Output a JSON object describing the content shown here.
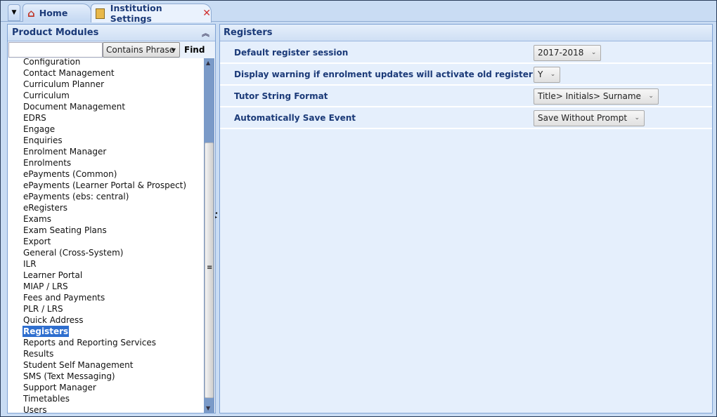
{
  "tabs": [
    {
      "label": "Home",
      "icon": "home-icon"
    },
    {
      "label": "Institution Settings",
      "icon": "settings-document-icon",
      "active": true
    }
  ],
  "left_panel": {
    "title": "Product Modules",
    "search": {
      "value": "",
      "mode": "Contains Phrase",
      "find_label": "Find"
    },
    "items": [
      "Configuration",
      "Contact Management",
      "Curriculum Planner",
      "Curriculum",
      "Document Management",
      "EDRS",
      "Engage",
      "Enquiries",
      "Enrolment Manager",
      "Enrolments",
      "ePayments (Common)",
      "ePayments (Learner Portal & Prospect)",
      "ePayments (ebs: central)",
      "eRegisters",
      "Exams",
      "Exam Seating Plans",
      "Export",
      "General (Cross-System)",
      "ILR",
      "Learner Portal",
      "MIAP / LRS",
      "Fees and Payments",
      "PLR / LRS",
      "Quick Address",
      "Registers",
      "Reports and Reporting Services",
      "Results",
      "Student Self Management",
      "SMS (Text Messaging)",
      "Support Manager",
      "Timetables",
      "Users"
    ],
    "selected": "Registers"
  },
  "right_panel": {
    "title": "Registers",
    "settings": [
      {
        "label": "Default register session",
        "value": "2017-2018"
      },
      {
        "label": "Display warning if enrolment updates will activate old register slots",
        "value": "Y"
      },
      {
        "label": "Tutor String Format",
        "value": "Title> Initials> Surname"
      },
      {
        "label": "Automatically Save Event",
        "value": "Save Without Prompt"
      }
    ]
  }
}
